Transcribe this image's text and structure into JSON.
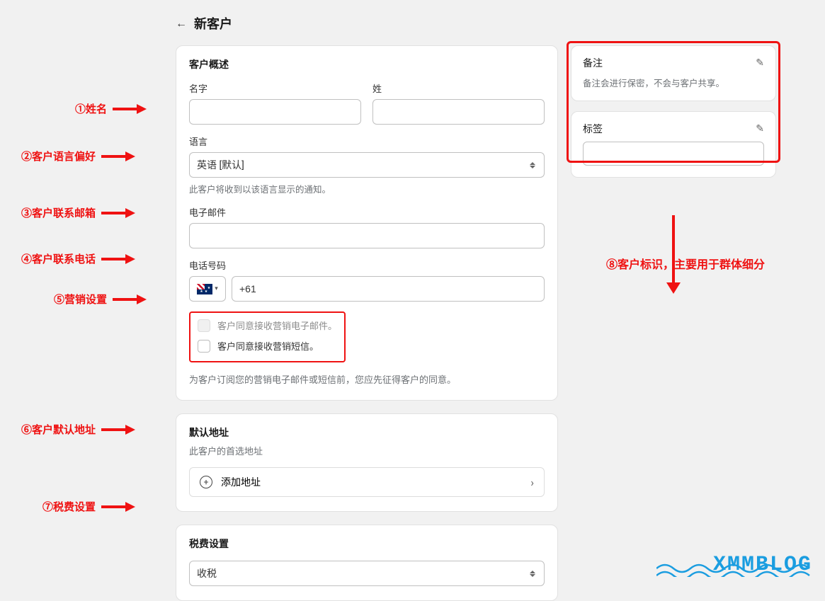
{
  "page": {
    "title": "新客户"
  },
  "overview": {
    "heading": "客户概述",
    "first_name_label": "名字",
    "last_name_label": "姓",
    "language_label": "语言",
    "language_value": "英语 [默认]",
    "language_hint": "此客户将收到以该语言显示的通知。",
    "email_label": "电子邮件",
    "phone_label": "电话号码",
    "phone_prefix": "+61",
    "marketing_email_label": "客户同意接收营销电子邮件。",
    "marketing_sms_label": "客户同意接收营销短信。",
    "consent_note": "为客户订阅您的营销电子邮件或短信前，您应先征得客户的同意。"
  },
  "address": {
    "heading": "默认地址",
    "sub": "此客户的首选地址",
    "add_label": "添加地址"
  },
  "tax": {
    "heading": "税费设置",
    "value": "收税"
  },
  "notes": {
    "heading": "备注",
    "desc": "备注会进行保密，不会与客户共享。"
  },
  "tags": {
    "heading": "标签"
  },
  "annot": {
    "a1": "①姓名",
    "a2": "②客户语言偏好",
    "a3": "③客户联系邮箱",
    "a4": "④客户联系电话",
    "a5": "⑤营销设置",
    "a6": "⑥客户默认地址",
    "a7": "⑦税费设置",
    "a8": "⑧客户标识，主要用于群体细分"
  },
  "watermark": "XMMBLOG"
}
